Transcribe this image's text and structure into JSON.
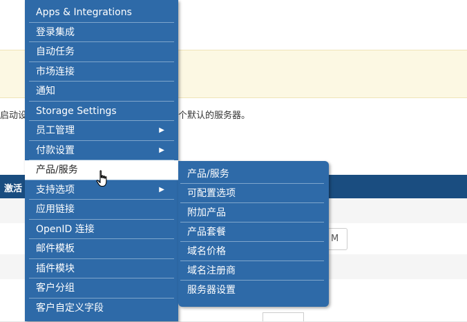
{
  "background": {
    "left_text": "启动设",
    "right_text": "个默认的服务器。",
    "table_header_text": "激活",
    "input_value": "M"
  },
  "main_menu": {
    "items": [
      {
        "label": "Apps & Integrations",
        "has_submenu": false
      },
      {
        "label": "登录集成",
        "has_submenu": false
      },
      {
        "label": "自动任务",
        "has_submenu": false
      },
      {
        "label": "市场连接",
        "has_submenu": false
      },
      {
        "label": "通知",
        "has_submenu": false
      },
      {
        "label": "Storage Settings",
        "has_submenu": false
      },
      {
        "label": "员工管理",
        "has_submenu": true
      },
      {
        "label": "付款设置",
        "has_submenu": true
      },
      {
        "label": "产品/服务",
        "has_submenu": true,
        "active": true
      },
      {
        "label": "支持选项",
        "has_submenu": true
      },
      {
        "label": "应用链接",
        "has_submenu": false
      },
      {
        "label": "OpenID 连接",
        "has_submenu": false
      },
      {
        "label": "邮件模板",
        "has_submenu": false
      },
      {
        "label": "插件模块",
        "has_submenu": false
      },
      {
        "label": "客户分组",
        "has_submenu": false
      },
      {
        "label": "客户自定义字段",
        "has_submenu": false
      }
    ],
    "arrow_glyph": "▶"
  },
  "sub_menu": {
    "items": [
      {
        "label": "产品/服务"
      },
      {
        "label": "可配置选项"
      },
      {
        "label": "附加产品"
      },
      {
        "label": "产品套餐"
      },
      {
        "label": "域名价格"
      },
      {
        "label": "域名注册商"
      },
      {
        "label": "服务器设置"
      }
    ]
  },
  "colors": {
    "menu_bg": "#2e6aa8",
    "menu_divider": "#7fa6cc",
    "notice_bg": "#fcf8e3",
    "table_header_bg": "#1a4d80"
  },
  "icons": {
    "cursor": "hand-pointer-icon"
  }
}
